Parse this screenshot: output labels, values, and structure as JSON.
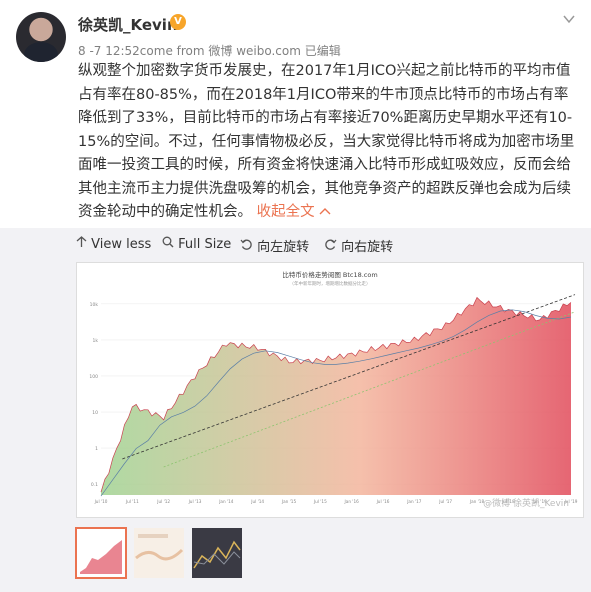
{
  "post": {
    "author": "徐英凯_Kevin",
    "badge_icon": "v-badge-icon",
    "meta": "8 -7 12:52come from 微博 weibo.com   已编辑",
    "text": "纵观整个加密数字货币发展史，在2017年1月ICO兴起之前比特币的平均市值占有率在80-85%，而在2018年1月ICO带来的牛市顶点比特币的市场占有率降低到了33%，目前比特币的市场占有率接近70%距离历史早期水平还有10-15%的空间。不过，任何事情物极必反，当大家觉得比特币将成为加密市场里面唯一投资工具的时候，所有资金将快速涌入比特币形成虹吸效应，反而会给其他主流币主力提供洗盘吸筹的机会，其他竞争资产的超跌反弹也会成为后续资金轮动中的确定性机会。",
    "collapse_label": "收起全文",
    "accent": "#eb7350"
  },
  "toolbar": {
    "view_less": "View less",
    "full_size": "Full Size",
    "rotate_left": "向左旋转",
    "rotate_right": "向右旋转"
  },
  "chart": {
    "title": "比特币价格走势阅图 Btc18.com",
    "subtitle": "（年中新年期时，增期增比数据分比走）",
    "watermark": "@微博 徐英凯_Kevin"
  },
  "chart_data": {
    "type": "area",
    "title": "比特币价格走势阅图 Btc18.com",
    "scale": "log",
    "x": [
      "Jul '10",
      "Jul '11",
      "Jul '12",
      "Jul '13",
      "Jan '14",
      "Jul '14",
      "Jan '15",
      "Jul '15",
      "Jan '16",
      "Jul '16",
      "Jan '17",
      "Jul '17",
      "Jan '18",
      "Jul '18",
      "Jan '19",
      "Jul '19"
    ],
    "yticks": [
      "10k",
      "1k",
      "100",
      "10",
      "1",
      "0.1"
    ],
    "series": [
      {
        "values": [
          0.06,
          15,
          7,
          100,
          800,
          600,
          250,
          270,
          400,
          650,
          1000,
          2500,
          13000,
          6500,
          3600,
          11000
        ]
      }
    ]
  }
}
